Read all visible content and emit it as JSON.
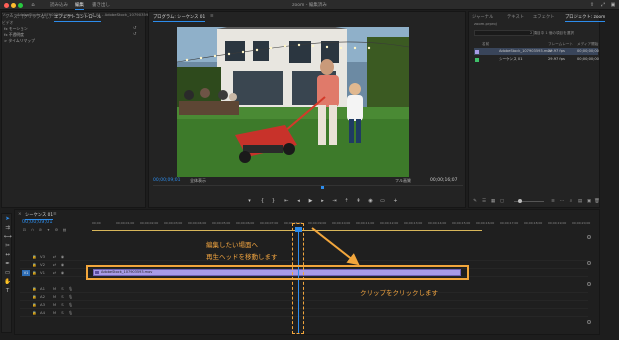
{
  "window": {
    "title": "zoom - 編集済み",
    "workspace_tabs": [
      "読み込み",
      "編集",
      "書き出し"
    ],
    "active_workspace": "編集"
  },
  "effect_controls": {
    "tabs": [
      "ソース:（クリップなし）",
      "エフェクトコントロール"
    ],
    "clip_source": "ソース - AdobeStock_107903593.mov",
    "clip_sequence": "シーケンス 01 - AdobeStock_107903593.mov",
    "section_video": "ビデオ",
    "rows": [
      "fx  モーション",
      "fx  不透明度",
      "> タイムリマップ"
    ]
  },
  "program_monitor": {
    "title": "プログラム: シーケンス 01",
    "timecode_current": "00;00;09;01",
    "fit_label": "全体表示",
    "resolution_label": "フル画質",
    "timecode_duration": "00;00;16;07",
    "transport_icons": [
      "marker-icon",
      "in-point-icon",
      "out-point-icon",
      "go-to-in-icon",
      "step-back-icon",
      "play-icon",
      "step-forward-icon",
      "go-to-out-icon",
      "lift-icon",
      "extract-icon",
      "export-frame-icon",
      "comparison-icon",
      "add-icon"
    ]
  },
  "project_panel": {
    "tabs": [
      "ジャーナル",
      "テキスト",
      "エフェクト",
      "プロジェクト: zoom"
    ],
    "file_name": "zoom.prproj",
    "item_count": "2 項目中 1 個の項目を選択",
    "columns": {
      "name": "名前",
      "frame_rate": "フレームレート",
      "media_start": "メディア開始"
    },
    "items": [
      {
        "name": "AdobeStock_107903593.mov",
        "frame_rate": "29.97 fps",
        "media_start": "00;00;00;00",
        "color": "#a89be6",
        "selected": true
      },
      {
        "name": "シーケンス 01",
        "frame_rate": "29.97 fps",
        "media_start": "00;00;00;00",
        "color": "#3fbf6a",
        "selected": false
      }
    ]
  },
  "timeline": {
    "tab": "シーケンス 01",
    "timecode": "00;00;09;01",
    "ruler_labels": [
      "00;00",
      "00;00;01;00",
      "00;00;02;00",
      "00;00;03;00",
      "00;00;04;00",
      "00;00;05;00",
      "00;00;06;00",
      "00;00;07;00",
      "00;00;08;00",
      "00;00;09;00",
      "00;00;10;00",
      "00;00;11;00",
      "00;00;12;00",
      "00;00;13;00",
      "00;00;14;00",
      "00;00;15;00",
      "00;00;16;00",
      "00;00;17;00",
      "00;00;18;00",
      "00;00;19;00",
      "00;00;20;00"
    ],
    "video_tracks": [
      "V3",
      "V2",
      "V1"
    ],
    "audio_tracks": [
      "A1",
      "A2",
      "A3",
      "A4"
    ],
    "source_patch": "V1",
    "clip_name": "AdobeStock_107903593.mov"
  },
  "annotations": {
    "step1_line1": "編集したい場面へ",
    "step1_line2": "再生ヘッドを移動します",
    "step2": "クリップをクリックします",
    "color": "#f2a63c"
  }
}
